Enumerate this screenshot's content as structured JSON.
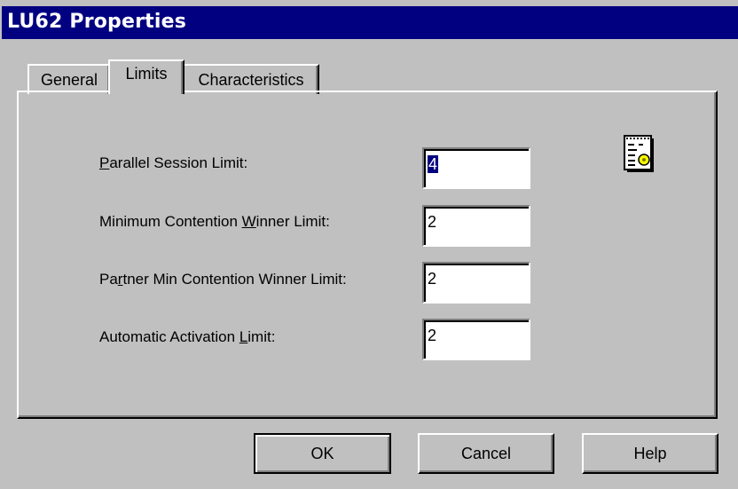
{
  "window": {
    "title": "LU62 Properties"
  },
  "tabs": [
    {
      "label": "General",
      "active": false
    },
    {
      "label": "Limits",
      "active": true
    },
    {
      "label": "Characteristics",
      "active": false
    }
  ],
  "fields": {
    "parallel_session_limit": {
      "label_pre": "",
      "label_accel": "P",
      "label_post": "arallel Session Limit:",
      "value": "4"
    },
    "min_contention_winner_limit": {
      "label_pre": "Minimum Contention ",
      "label_accel": "W",
      "label_post": "inner Limit:",
      "value": "2"
    },
    "partner_min_contention_winner_limit": {
      "label_pre": "Pa",
      "label_accel": "r",
      "label_post": "tner Min Contention Winner Limit:",
      "value": "2"
    },
    "automatic_activation_limit": {
      "label_pre": "Automatic Activation ",
      "label_accel": "L",
      "label_post": "imit:",
      "value": "2"
    }
  },
  "buttons": {
    "ok": "OK",
    "cancel": "Cancel",
    "help": "Help"
  },
  "icons": {
    "properties_document": "document-properties-icon"
  },
  "colors": {
    "titlebar": "#000080",
    "dialog_face": "#c0c0c0",
    "selection": "#000080"
  }
}
